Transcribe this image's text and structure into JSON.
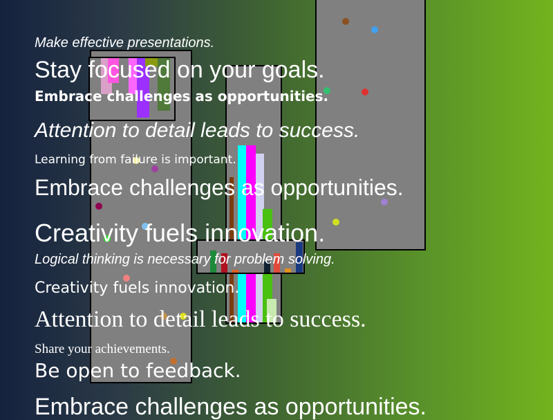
{
  "lines": [
    "Make effective presentations.",
    "Stay focused on your goals.",
    "Embrace challenges as opportunities.",
    "Attention to detail leads to success.",
    "Learning from failure is important.",
    "Embrace challenges as opportunities.",
    "Creativity fuels innovation.",
    "Logical thinking is necessary for problem solving.",
    "Creativity fuels innovation.",
    "Attention to detail leads to success.",
    "Share your achievements.",
    "Be open to feedback.",
    "Embrace challenges as opportunities."
  ],
  "colors": {
    "panel": "#808080",
    "text": "#ffffff",
    "gradient_left": "#15223f",
    "gradient_right": "#72b31e"
  }
}
